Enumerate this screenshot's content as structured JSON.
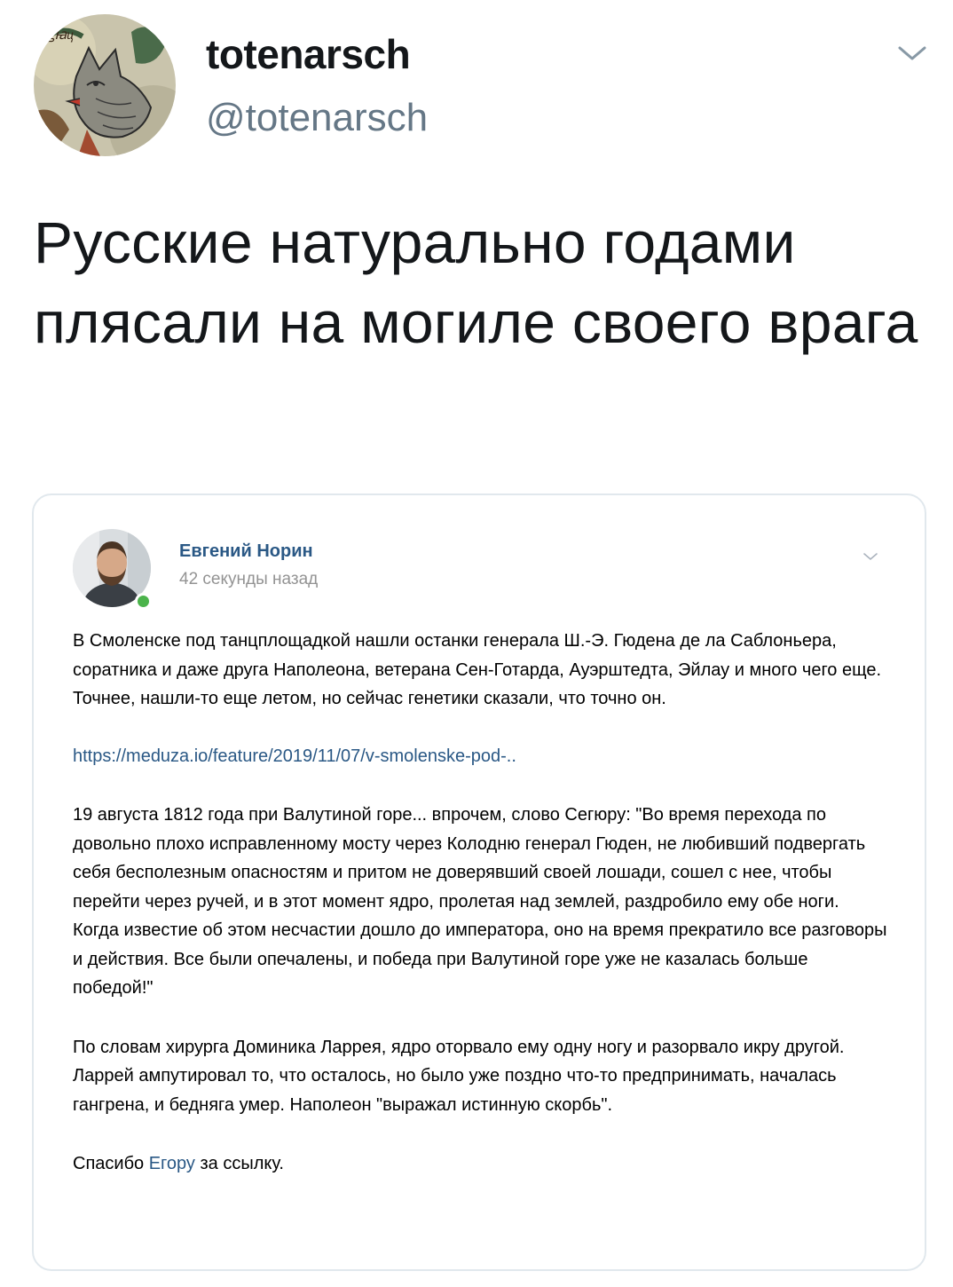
{
  "tweet": {
    "display_name": "totenarsch",
    "handle": "@totenarsch",
    "text": "Русские натурально годами плясали на могиле своего врага",
    "avatar_icon": "illustrated-wolf-avatar",
    "menu_icon": "chevron-down-icon"
  },
  "quoted_post": {
    "author": "Евгений Норин",
    "time": "42 секунды назад",
    "paragraph_1": "В Смоленске под танцплощадкой нашли останки генерала Ш.-Э. Гюдена де ла Саблоньера, соратника и даже друга Наполеона, ветерана Сен-Готарда, Ауэрштедта, Эйлау и много чего еще. Точнее, нашли-то еще летом, но сейчас генетики сказали, что точно он.",
    "link": "https://meduza.io/feature/2019/11/07/v-smolenske-pod-..",
    "paragraph_2": "19 августа 1812 года при Валутиной горе... впрочем, слово Сегюру: \"Во время перехода по довольно плохо исправленному мосту через Колодню генерал Гюден, не любивший подвергать себя бесполезным опасностям и притом не доверявший своей лошади, сошел с нее, чтобы перейти через ручей, и в этот момент ядро, пролетая над землей, раздробило ему обе ноги. Когда известие об этом несчастии дошло до императора, оно на время прекратило все разговоры и действия. Все были опечалены, и победа при Валутиной горе уже не казалась больше победой!\"",
    "paragraph_3": "По словам хирурга Доминика Ларрея, ядро оторвало ему одну ногу и разорвало икру другой. Ларрей ампутировал то, что осталось, но было уже поздно что-то предпринимать, началась гангрена, и бедняга умер. Наполеон \"выражал истинную скорбь\".",
    "thanks_prefix": "Спасибо",
    "thanks_link": "Егору",
    "thanks_suffix": "за ссылку.",
    "online_status_color": "#4bb34b",
    "link_color": "#2a5885"
  }
}
